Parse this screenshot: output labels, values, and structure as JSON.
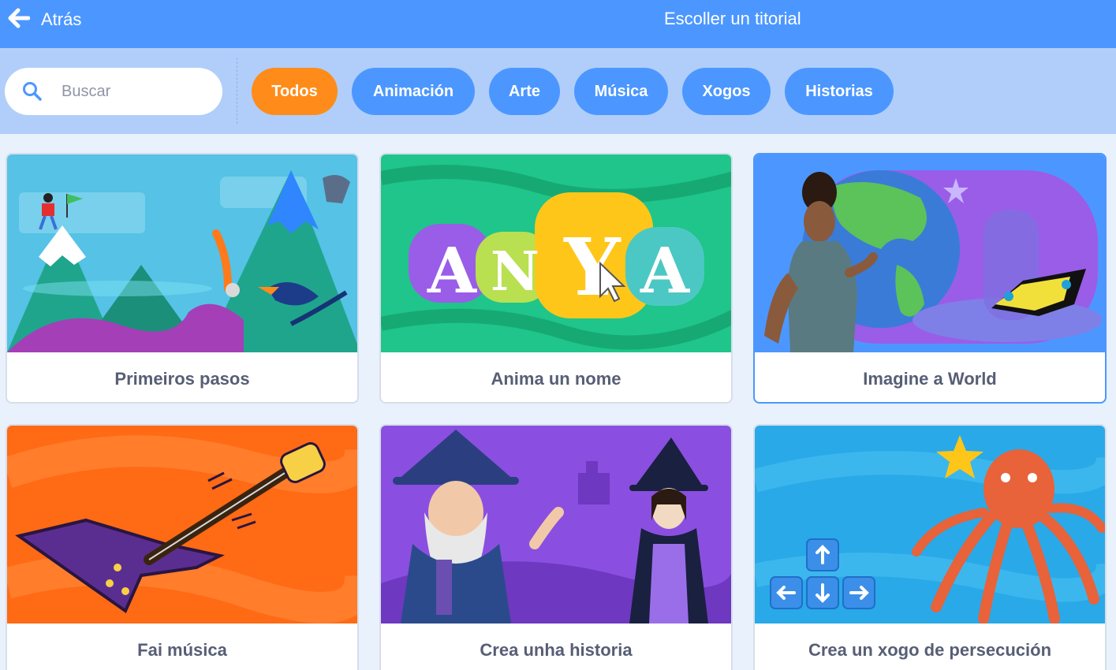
{
  "header": {
    "back_label": "Atrás",
    "title": "Escoller un titorial"
  },
  "search": {
    "placeholder": "Buscar",
    "value": ""
  },
  "filters": [
    {
      "label": "Todos",
      "active": true
    },
    {
      "label": "Animación",
      "active": false
    },
    {
      "label": "Arte",
      "active": false
    },
    {
      "label": "Música",
      "active": false
    },
    {
      "label": "Xogos",
      "active": false
    },
    {
      "label": "Historias",
      "active": false
    }
  ],
  "tutorials": [
    {
      "title": "Primeiros pasos"
    },
    {
      "title": "Anima un nome",
      "art_text": "ANYA"
    },
    {
      "title": "Imagine a World",
      "selected": true
    },
    {
      "title": "Fai música"
    },
    {
      "title": "Crea unha historia"
    },
    {
      "title": "Crea un xogo de persecución"
    }
  ],
  "colors": {
    "header": "#4c97ff",
    "filterbar": "#b0cef9",
    "active_filter": "#ff8c1a",
    "text": "#575e75"
  }
}
